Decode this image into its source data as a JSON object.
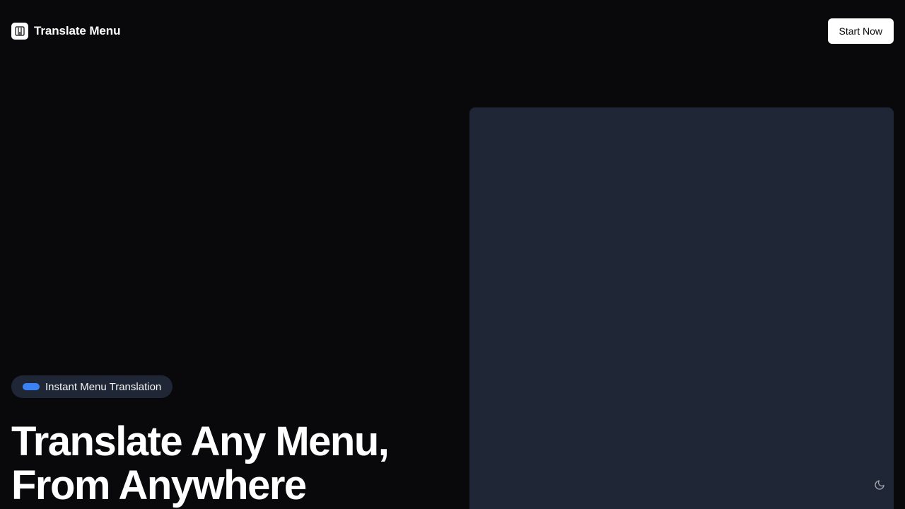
{
  "header": {
    "brand_name": "Translate Menu",
    "logo_icon": "menu-book-icon",
    "cta_label": "Start Now"
  },
  "hero": {
    "badge_label": "Instant Menu Translation",
    "headline_line1": "Translate Any Menu,",
    "headline_line2": "From Anywhere"
  },
  "theme_toggle": {
    "icon": "moon-icon"
  },
  "colors": {
    "background": "#09090b",
    "panel": "#1f2737",
    "accent": "#3b82f6",
    "button_bg": "#ffffff",
    "button_text": "#09090b"
  }
}
